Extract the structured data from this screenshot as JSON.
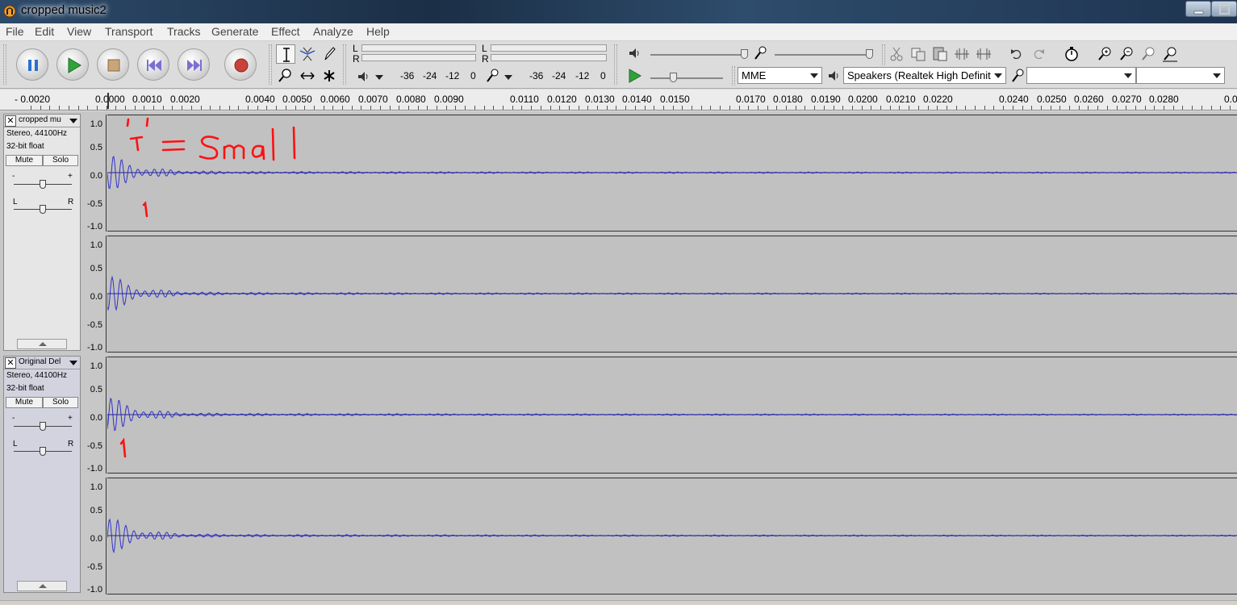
{
  "window": {
    "title": "cropped music2",
    "minimize": "minimize",
    "maximize": "maximize"
  },
  "menu": [
    "File",
    "Edit",
    "View",
    "Transport",
    "Tracks",
    "Generate",
    "Effect",
    "Analyze",
    "Help"
  ],
  "transport": {
    "pause": "pause",
    "play": "play",
    "stop": "stop",
    "skip_start": "skip to start",
    "skip_end": "skip to end",
    "record": "record"
  },
  "meters": {
    "play_L": "L",
    "play_R": "R",
    "rec_L": "L",
    "rec_R": "R",
    "scale_play": [
      "-36",
      "-24",
      "-12",
      "0"
    ],
    "scale_rec": [
      "-36",
      "-24",
      "-12",
      "0"
    ]
  },
  "devices": {
    "host": "MME",
    "output": "Speakers (Realtek High Definit",
    "input": "",
    "channels": ""
  },
  "ruler": {
    "labels": [
      "- 0.0020",
      "0.0000",
      "0.0010",
      "0.0020",
      "0.0040",
      "0.0050",
      "0.0060",
      "0.0070",
      "0.0080",
      "0.0090",
      "0.0110",
      "0.0120",
      "0.0130",
      "0.0140",
      "0.0150",
      "0.0170",
      "0.0180",
      "0.0190",
      "0.0200",
      "0.0210",
      "0.0220",
      "0.0240",
      "0.0250",
      "0.0260",
      "0.0270",
      "0.0280",
      "0.0"
    ]
  },
  "tracks": [
    {
      "name": "cropped mu",
      "rate": "Stereo, 44100Hz",
      "format": "32-bit float",
      "mute": "Mute",
      "solo": "Solo",
      "gain_minus": "-",
      "gain_plus": "+",
      "pan_left": "L",
      "pan_right": "R",
      "scale": [
        "1.0",
        "0.5",
        "0.0",
        "-0.5",
        "-1.0"
      ],
      "annotation": "'T' = Small"
    },
    {
      "name": "Original Del",
      "rate": "Stereo, 44100Hz",
      "format": "32-bit float",
      "mute": "Mute",
      "solo": "Solo",
      "gain_minus": "-",
      "gain_plus": "+",
      "pan_left": "L",
      "pan_right": "R",
      "scale": [
        "1.0",
        "0.5",
        "0.0",
        "-0.5",
        "-1.0"
      ],
      "annotation": ""
    }
  ]
}
